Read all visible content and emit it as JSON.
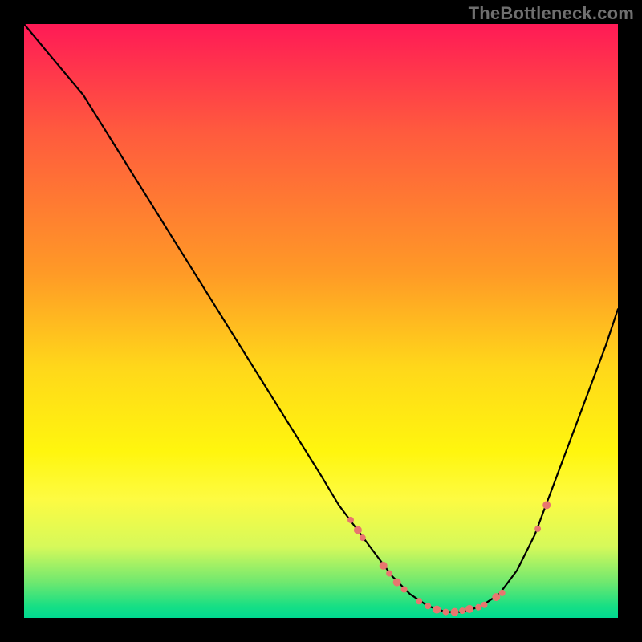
{
  "watermark": "TheBottleneck.com",
  "chart_data": {
    "type": "line",
    "title": "",
    "xlabel": "",
    "ylabel": "",
    "xlim": [
      0,
      100
    ],
    "ylim": [
      0,
      100
    ],
    "grid": false,
    "series": [
      {
        "name": "curve",
        "x": [
          0,
          5,
          10,
          15,
          20,
          25,
          30,
          35,
          40,
          45,
          50,
          53,
          56,
          59,
          62,
          65,
          68,
          71,
          74,
          77,
          80,
          83,
          86,
          89,
          92,
          95,
          98,
          100
        ],
        "values": [
          100,
          94,
          88,
          80,
          72,
          64,
          56,
          48,
          40,
          32,
          24,
          19,
          15,
          11,
          7,
          4,
          2,
          1,
          1,
          2,
          4,
          8,
          14,
          22,
          30,
          38,
          46,
          52
        ]
      }
    ],
    "markers": [
      {
        "x": 55.0,
        "y": 16.5,
        "r": 4
      },
      {
        "x": 56.2,
        "y": 14.8,
        "r": 5
      },
      {
        "x": 57.0,
        "y": 13.5,
        "r": 4
      },
      {
        "x": 60.5,
        "y": 8.8,
        "r": 5
      },
      {
        "x": 61.5,
        "y": 7.5,
        "r": 4
      },
      {
        "x": 62.8,
        "y": 6.0,
        "r": 5
      },
      {
        "x": 64.0,
        "y": 4.8,
        "r": 4
      },
      {
        "x": 66.5,
        "y": 2.8,
        "r": 4
      },
      {
        "x": 68.0,
        "y": 2.0,
        "r": 4
      },
      {
        "x": 69.5,
        "y": 1.4,
        "r": 5
      },
      {
        "x": 71.0,
        "y": 1.0,
        "r": 4
      },
      {
        "x": 72.5,
        "y": 1.0,
        "r": 5
      },
      {
        "x": 73.8,
        "y": 1.2,
        "r": 4
      },
      {
        "x": 75.0,
        "y": 1.5,
        "r": 5
      },
      {
        "x": 76.5,
        "y": 1.8,
        "r": 4
      },
      {
        "x": 77.5,
        "y": 2.2,
        "r": 4
      },
      {
        "x": 79.5,
        "y": 3.5,
        "r": 5
      },
      {
        "x": 80.5,
        "y": 4.2,
        "r": 4
      },
      {
        "x": 86.5,
        "y": 15.0,
        "r": 4
      },
      {
        "x": 88.0,
        "y": 19.0,
        "r": 5
      }
    ],
    "colors": {
      "curve": "#000000",
      "marker": "#e8766f",
      "gradient_top": "#ff1a56",
      "gradient_bottom": "#00d990"
    }
  }
}
